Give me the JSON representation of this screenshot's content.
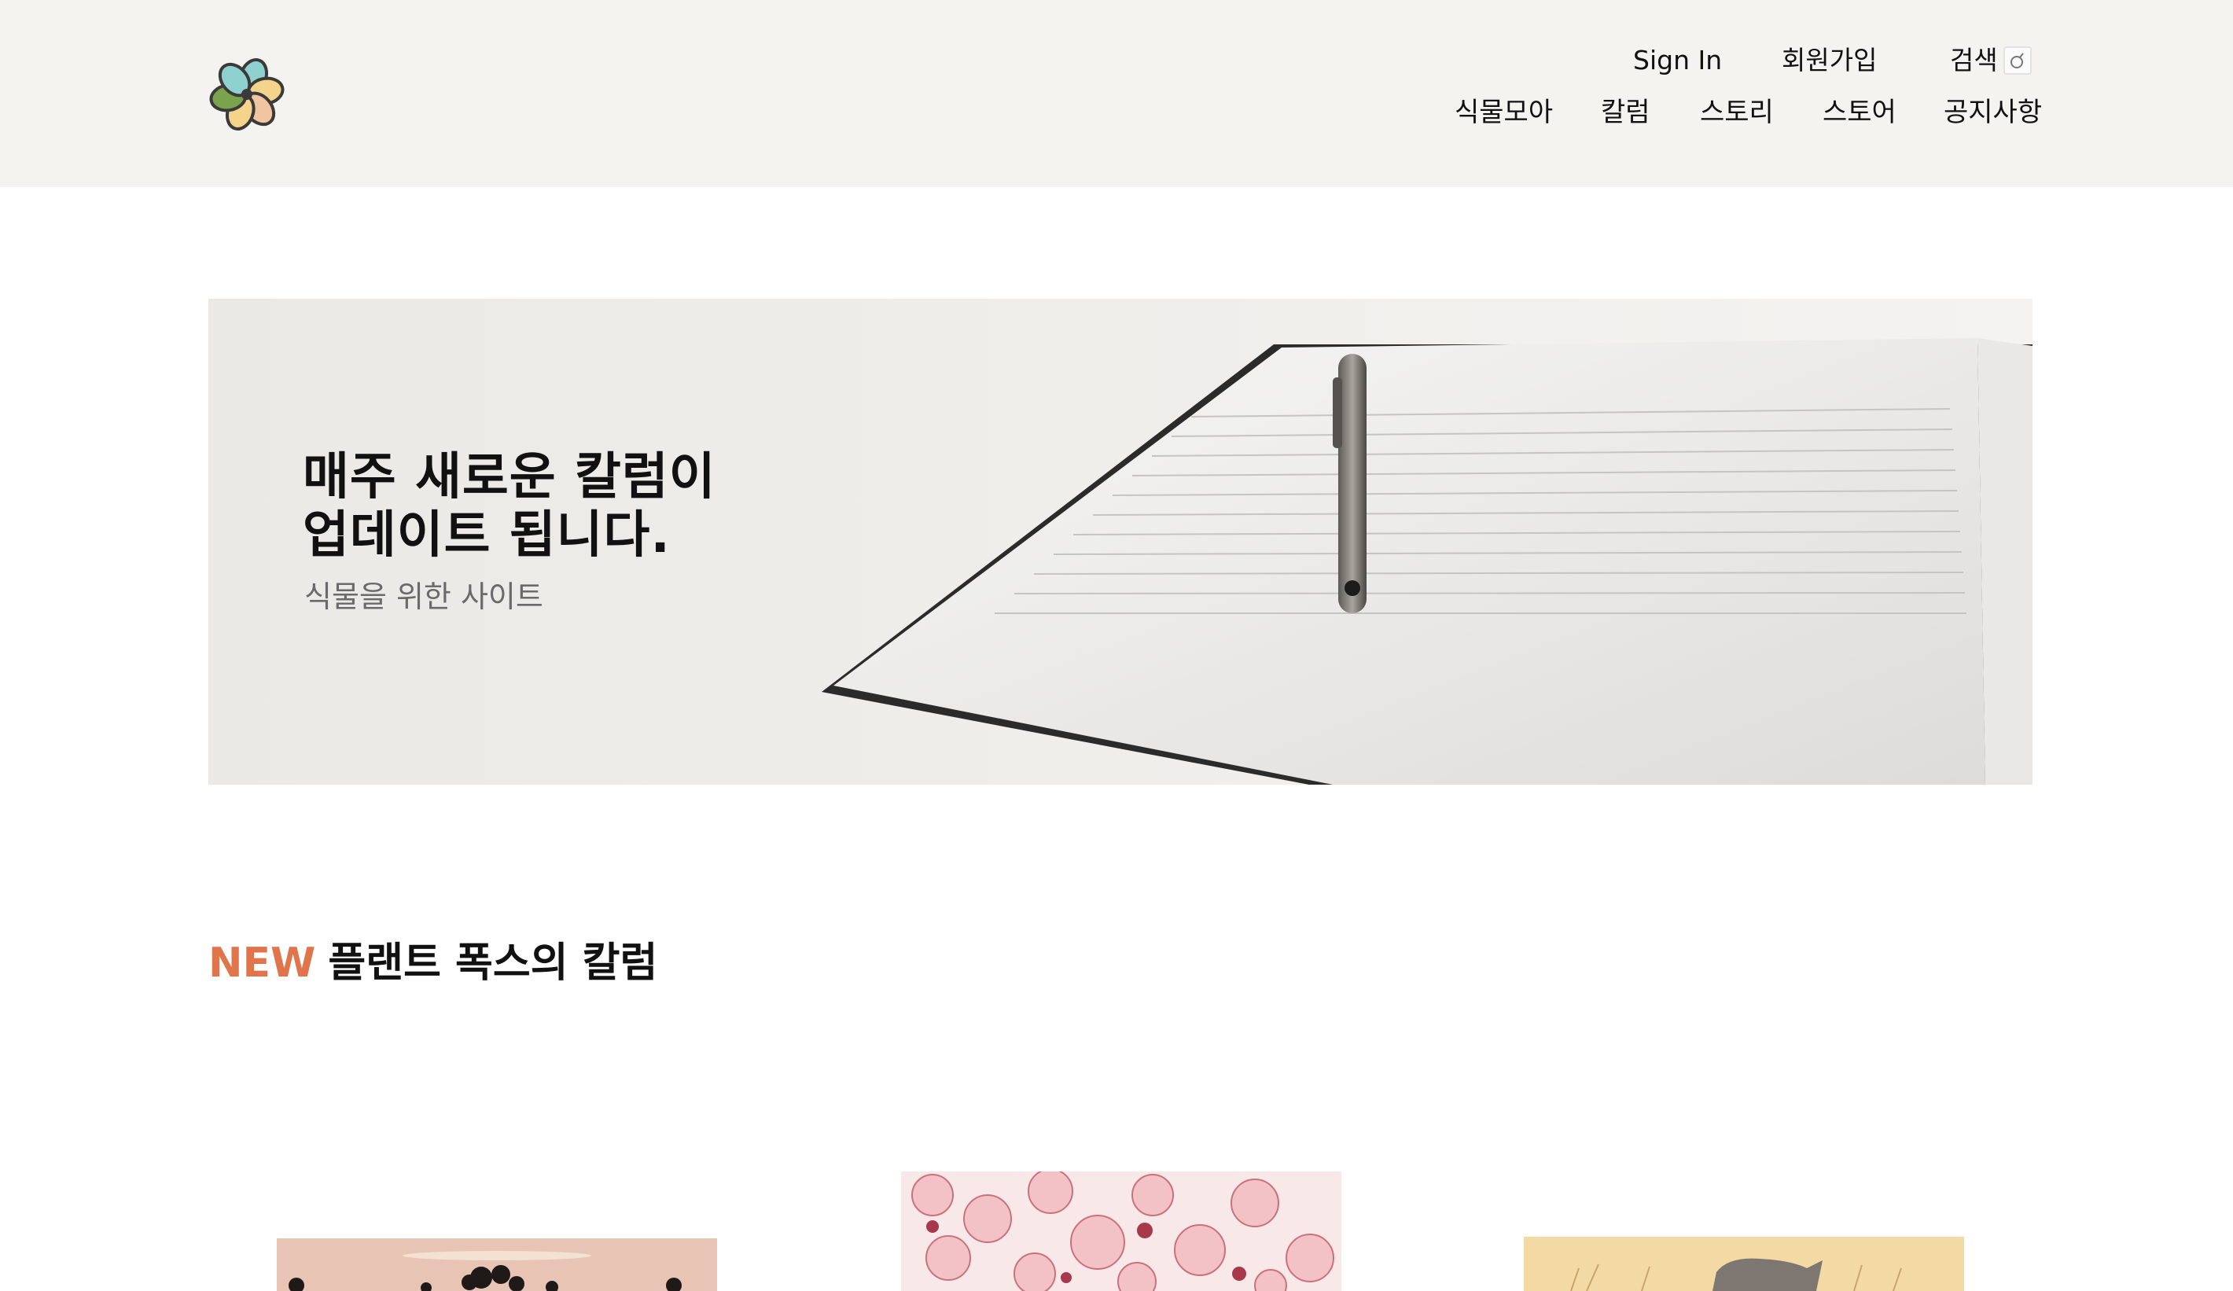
{
  "header": {
    "logo_name": "flower-logo",
    "util_nav": [
      {
        "label": "Sign In"
      },
      {
        "label": "회원가입"
      },
      {
        "label": "검색"
      }
    ],
    "main_nav": [
      {
        "label": "식물모아"
      },
      {
        "label": "칼럼"
      },
      {
        "label": "스토리"
      },
      {
        "label": "스토어"
      },
      {
        "label": "공지사항"
      }
    ]
  },
  "banner": {
    "title_line1": "매주 새로운 칼럼이",
    "title_line2": "업데이트 됩니다.",
    "subtitle": "식물을 위한 사이트"
  },
  "section": {
    "new_label": "NEW",
    "title": "플랜트 폭스의 칼럼"
  },
  "colors": {
    "header_bg": "#f5f3ef",
    "accent": "#e0744a"
  }
}
